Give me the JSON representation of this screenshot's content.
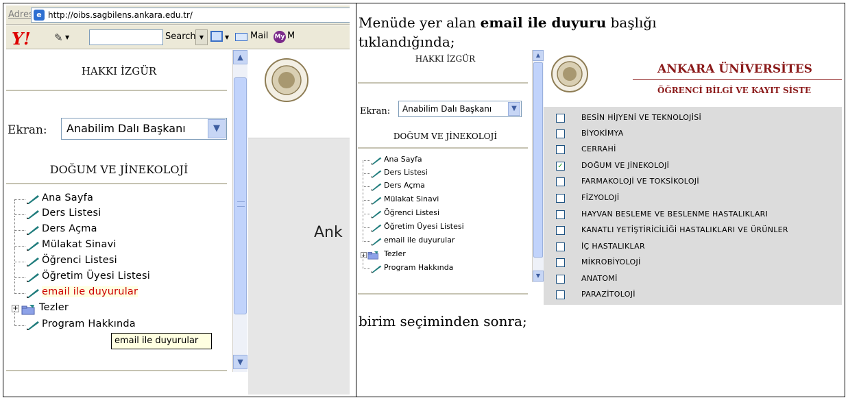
{
  "left_screenshot": {
    "address_label": "Adres",
    "url": "http://oibs.sagbilens.ankara.edu.tr/",
    "toolbar": {
      "logo": "Y!",
      "search_button": "Search",
      "mail": "Mail",
      "my_badge": "My",
      "my_text": "M"
    },
    "user_name": "HAKKI İZGÜR",
    "screen_label": "Ekran:",
    "screen_value": "Anabilim Dalı Başkanı",
    "department": "DOĞUM VE JİNEKOLOJİ",
    "menu": [
      {
        "label": "Ana Sayfa"
      },
      {
        "label": "Ders Listesi"
      },
      {
        "label": "Ders Açma"
      },
      {
        "label": "Mülakat Sinavi"
      },
      {
        "label": "Öğrenci Listesi"
      },
      {
        "label": "Öğretim Üyesi Listesi"
      },
      {
        "label": "email ile duyurular"
      },
      {
        "label": "Tezler"
      },
      {
        "label": "Program Hakkında"
      }
    ],
    "tooltip": "email ile duyurular",
    "right_frame_text": "Ank"
  },
  "caption_top_line1_pre": "Menüde yer alan ",
  "caption_top_line1_bold": "email ile duyuru",
  "caption_top_line1_post": " başlığı",
  "caption_top_line2": "tıklandığında;",
  "caption_bottom": "birim seçiminden sonra;",
  "right_screenshot": {
    "user_name": "HAKKI İZGÜR",
    "screen_label": "Ekran:",
    "screen_value": "Anabilim Dalı Başkanı",
    "department": "DOĞUM VE JİNEKOLOJİ",
    "menu": [
      {
        "label": "Ana Sayfa"
      },
      {
        "label": "Ders Listesi"
      },
      {
        "label": "Ders Açma"
      },
      {
        "label": "Mülakat Sinavi"
      },
      {
        "label": "Öğrenci Listesi"
      },
      {
        "label": "Öğretim Üyesi Listesi"
      },
      {
        "label": "email ile duyurular"
      },
      {
        "label": "Tezler"
      },
      {
        "label": "Program Hakkında"
      }
    ],
    "university": "ANKARA ÜNİVERSİTES",
    "system": "ÖĞRENCİ BİLGİ VE KAYIT SİSTE",
    "units": [
      {
        "label": "BESİN HİJYENİ VE TEKNOLOJİSİ",
        "checked": false
      },
      {
        "label": "BİYOKİMYA",
        "checked": false
      },
      {
        "label": "CERRAHİ",
        "checked": false
      },
      {
        "label": "DOĞUM VE JİNEKOLOJİ",
        "checked": true
      },
      {
        "label": "FARMAKOLOJİ VE TOKSİKOLOJİ",
        "checked": false
      },
      {
        "label": "FİZYOLOJİ",
        "checked": false
      },
      {
        "label": "HAYVAN BESLEME VE BESLENME HASTALIKLARI",
        "checked": false
      },
      {
        "label": " KANATLI YETİŞTİRİCİLİĞİ HASTALIKLARI VE ÜRÜNLER",
        "checked": false
      },
      {
        "label": "İÇ HASTALIKLAR",
        "checked": false
      },
      {
        "label": "MİKROBİYOLOJİ",
        "checked": false
      },
      {
        "label": "ANATOMİ",
        "checked": false
      },
      {
        "label": "PARAZİTOLOJİ",
        "checked": false
      }
    ]
  }
}
